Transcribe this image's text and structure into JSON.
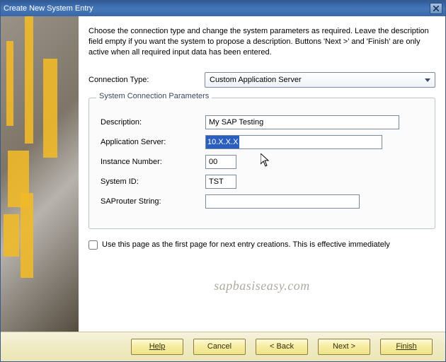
{
  "window_title": "Create New System Entry",
  "intro_text": "Choose the connection type and change the system parameters as required. Leave the description field empty if you want the system to propose a description. Buttons 'Next >' and 'Finish' are only active when all required input data has been entered.",
  "connection_type": {
    "label": "Connection Type:",
    "value": "Custom Application Server"
  },
  "group": {
    "legend": "System Connection Parameters",
    "description": {
      "label": "Description:",
      "value": "My SAP Testing"
    },
    "app_server": {
      "label": "Application Server:",
      "value": "10.X.X.X"
    },
    "instance_number": {
      "label": "Instance Number:",
      "value": "00"
    },
    "system_id": {
      "label": "System ID:",
      "value": "TST"
    },
    "saprouter": {
      "label": "SAProuter String:",
      "value": ""
    }
  },
  "checkbox_label": "Use this page as the first page for next entry creations. This is effective immediately",
  "watermark": "sapbasiseasy.com",
  "buttons": {
    "help": "Help",
    "cancel": "Cancel",
    "back": "< Back",
    "next": "Next >",
    "finish": "Finish"
  }
}
